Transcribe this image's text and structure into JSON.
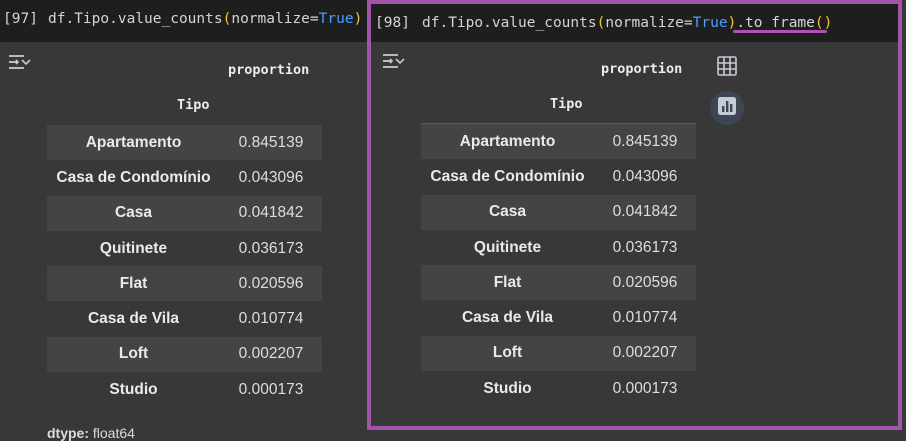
{
  "cells": [
    {
      "exec_count": "[97]",
      "code": {
        "prefix": "df.Tipo.value_counts",
        "open": "(",
        "arg": "normalize=",
        "kw": "True",
        "close": ")",
        "suffix_dot_method": "",
        "suffix_open": "",
        "suffix_close": ""
      },
      "output": {
        "column_header": "proportion",
        "index_name": "Tipo",
        "rows": [
          {
            "label": "Apartamento",
            "value": "0.845139"
          },
          {
            "label": "Casa de Condomínio",
            "value": "0.043096"
          },
          {
            "label": "Casa",
            "value": "0.041842"
          },
          {
            "label": "Quitinete",
            "value": "0.036173"
          },
          {
            "label": "Flat",
            "value": "0.020596"
          },
          {
            "label": "Casa de Vila",
            "value": "0.010774"
          },
          {
            "label": "Loft",
            "value": "0.002207"
          },
          {
            "label": "Studio",
            "value": "0.000173"
          }
        ],
        "dtype_label": "dtype:",
        "dtype_value": " float64"
      }
    },
    {
      "exec_count": "[98]",
      "code": {
        "prefix": "df.Tipo.value_counts",
        "open": "(",
        "arg": "normalize=",
        "kw": "True",
        "close": ")",
        "suffix_dot_method": ".to_frame",
        "suffix_open": "(",
        "suffix_close": ")"
      },
      "output": {
        "column_header": "proportion",
        "index_name": "Tipo",
        "rows": [
          {
            "label": "Apartamento",
            "value": "0.845139"
          },
          {
            "label": "Casa de Condomínio",
            "value": "0.043096"
          },
          {
            "label": "Casa",
            "value": "0.041842"
          },
          {
            "label": "Quitinete",
            "value": "0.036173"
          },
          {
            "label": "Flat",
            "value": "0.020596"
          },
          {
            "label": "Casa de Vila",
            "value": "0.010774"
          },
          {
            "label": "Loft",
            "value": "0.002207"
          },
          {
            "label": "Studio",
            "value": "0.000173"
          }
        ]
      }
    }
  ],
  "icons": {
    "output_toggle": "output-settings-icon",
    "table_button": "table-view-icon",
    "chart_button": "chart-suggestion-icon"
  },
  "colors": {
    "highlight_frame": "#a254a9",
    "keyword": "#4a9dff",
    "paren": "#f0c43c"
  }
}
